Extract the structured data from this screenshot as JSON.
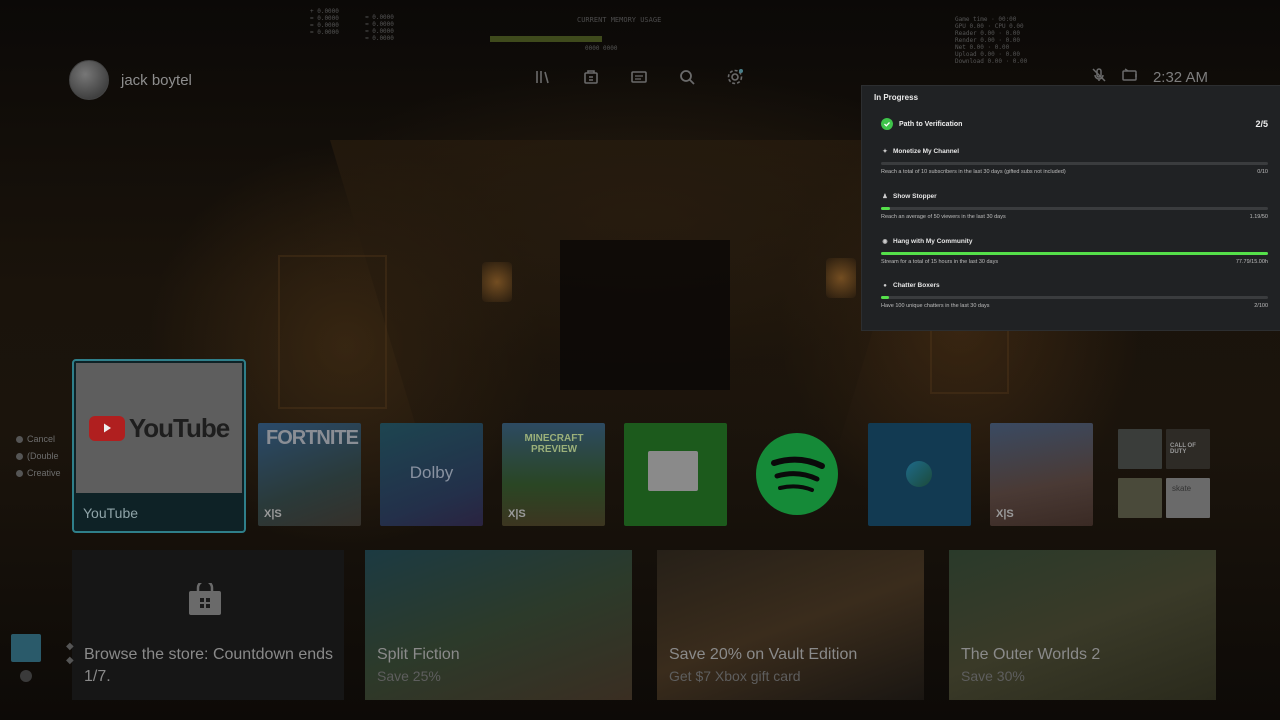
{
  "debug": {
    "top_left": "+ 0.0000\n= 0.0000\n= 0.0000\n= 0.0000",
    "top_mid_1": "≈ 0.0000\n≈ 0.0000\n≈ 0.0000\n≈ 0.0000",
    "top_center": "CURRENT MEMORY USAGE",
    "top_center_sub": "0000 0000",
    "top_right": "Game time · 00:00\nGPU 0.00 · CPU 0.00\nReader 0.00 · 0.00\nRender 0.00 · 0.00\nNet 0.00 · 0.00\nUpload 0.00 · 0.00\nDownload 0.00 · 0.00"
  },
  "header": {
    "username": "jack boytel",
    "time": "2:32 AM",
    "nav": [
      "library-icon",
      "store-icon",
      "game-pass-icon",
      "search-icon",
      "settings-icon"
    ]
  },
  "progress": {
    "title": "In Progress",
    "path_label": "Path to Verification",
    "path_count": "2/5",
    "goals": [
      {
        "title": "Monetize My Channel",
        "desc": "Reach a total of 10 subscribers in the last 30 days (gifted subs not included)",
        "value": "0/10",
        "fraction": 0.0
      },
      {
        "title": "Show Stopper",
        "desc": "Reach an average of 50 viewers in the last 30 days",
        "value": "1.19/50",
        "fraction": 0.024
      },
      {
        "title": "Hang with My Community",
        "desc": "Stream for a total of 15 hours in the last 30 days",
        "value": "77.79/15.00h",
        "fraction": 1.0
      },
      {
        "title": "Chatter Boxers",
        "desc": "Have 100 unique chatters in the last 30 days",
        "value": "2/100",
        "fraction": 0.02
      }
    ]
  },
  "side_list": [
    "Cancel",
    "(Double",
    "Creative"
  ],
  "tiles": {
    "youtube_label": "YouTube",
    "youtube_logo": "YouTube",
    "fortnite": "FORTNITE",
    "dolby": "Dolby",
    "minecraft": "MINECRAFT PREVIEW",
    "xs": "X|S",
    "mini_1": "",
    "mini_2": "CALL OF DUTY",
    "mini_3": "",
    "mini_4": "skate"
  },
  "cards": [
    {
      "title": "Browse the store: Countdown ends 1/7.",
      "sub": ""
    },
    {
      "title": "Split Fiction",
      "sub": "Save 25%"
    },
    {
      "title": "Save 20% on Vault Edition",
      "sub": "Get $7 Xbox gift card"
    },
    {
      "title": "The Outer Worlds 2",
      "sub": "Save 30%"
    }
  ],
  "colors": {
    "accent_green": "#55e04a",
    "panel_bg": "#202224",
    "focus_border": "#2f7f8a"
  }
}
